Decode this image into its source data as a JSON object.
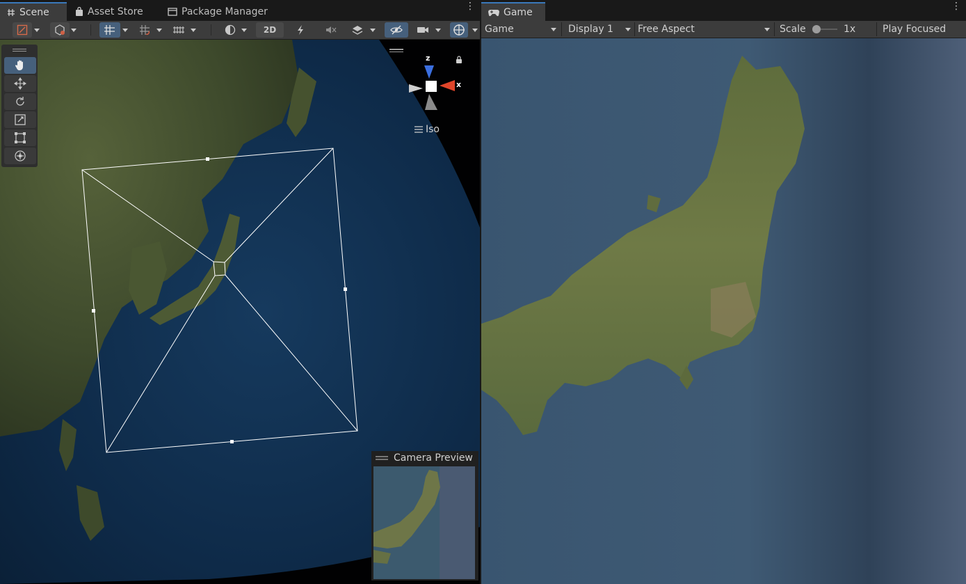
{
  "tabs": {
    "scene": "Scene",
    "asset_store": "Asset Store",
    "package_manager": "Package Manager",
    "game": "Game"
  },
  "scene_toolbar": {
    "mode_2d": "2D"
  },
  "scene_view": {
    "projection_label": "Iso",
    "axis_x": "x",
    "axis_z": "z"
  },
  "camera_preview": {
    "title": "Camera Preview"
  },
  "game_toolbar": {
    "view_select": "Game",
    "display_select": "Display 1",
    "aspect_select": "Free Aspect",
    "scale_label": "Scale",
    "scale_value": "1x",
    "scale_level": 0.0,
    "play_mode": "Play Focused"
  },
  "colors": {
    "accent_active": "#46607c",
    "tab_highlight": "#3a79bb",
    "axis_x": "#e0452a",
    "axis_z": "#3b6fe0"
  }
}
